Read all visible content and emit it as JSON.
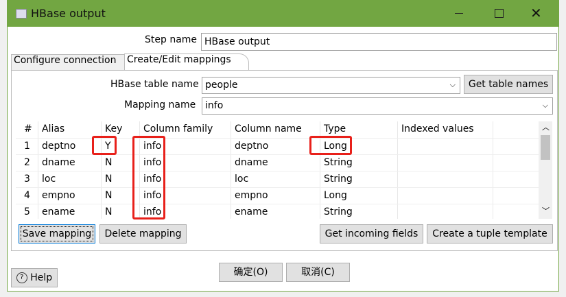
{
  "window": {
    "title": "HBase output",
    "app_icon": "hbase-step-icon",
    "controls": [
      "minimize-icon",
      "maximize-icon",
      "close-icon"
    ]
  },
  "step_name": {
    "label": "Step name",
    "value": "HBase output"
  },
  "tabs": [
    {
      "label": "Configure connection"
    },
    {
      "label": "Create/Edit mappings",
      "active": true
    }
  ],
  "hbase_table": {
    "label": "HBase table name",
    "value": "people",
    "button": "Get table names"
  },
  "mapping_name": {
    "label": "Mapping name",
    "value": "info"
  },
  "table": {
    "columns": [
      "#",
      "Alias",
      "Key",
      "Column family",
      "Column name",
      "Type",
      "Indexed values"
    ],
    "rows": [
      [
        "1",
        "deptno",
        "Y",
        "info",
        "deptno",
        "Long",
        ""
      ],
      [
        "2",
        "dname",
        "N",
        "info",
        "dname",
        "String",
        ""
      ],
      [
        "3",
        "loc",
        "N",
        "info",
        "loc",
        "String",
        ""
      ],
      [
        "4",
        "empno",
        "N",
        "info",
        "empno",
        "Long",
        ""
      ],
      [
        "5",
        "ename",
        "N",
        "info",
        "ename",
        "String",
        ""
      ]
    ]
  },
  "buttons": {
    "save": "Save mapping",
    "delete": "Delete mapping",
    "incoming": "Get incoming fields",
    "tuple": "Create a tuple template",
    "ok": "确定(O)",
    "cancel": "取消(C)",
    "help": "Help"
  },
  "highlight_color": "#e8201a",
  "title_bar_color": "#72a642"
}
